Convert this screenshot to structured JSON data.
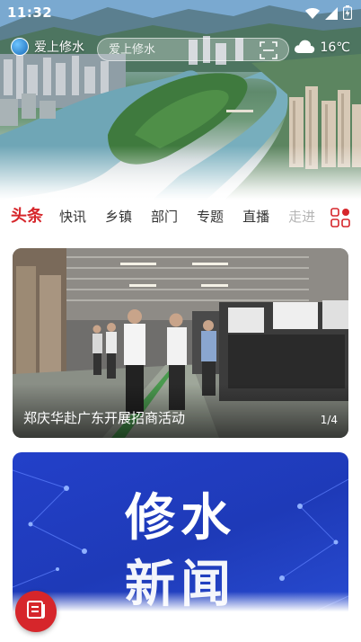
{
  "status_bar": {
    "time": "11:32",
    "icons": [
      "wifi-icon",
      "signal-icon",
      "battery-icon"
    ]
  },
  "header": {
    "app_name": "爱上修水",
    "search_placeholder": "爱上修水",
    "weather_temp": "16℃",
    "weather_icon": "cloud-icon"
  },
  "tabs": {
    "items": [
      {
        "label": "头条",
        "active": true
      },
      {
        "label": "快讯",
        "active": false
      },
      {
        "label": "乡镇",
        "active": false
      },
      {
        "label": "部门",
        "active": false
      },
      {
        "label": "专题",
        "active": false
      },
      {
        "label": "直播",
        "active": false
      },
      {
        "label": "走进",
        "active": false
      }
    ],
    "more_icon": "grid-menu-icon"
  },
  "feature": {
    "caption": "郑庆华赴广东开展招商活动",
    "counter": "1/4"
  },
  "promo": {
    "title": "修水",
    "subtitle": "新闻"
  },
  "colors": {
    "accent": "#d6262b",
    "promo_blue": "#2340c9"
  }
}
